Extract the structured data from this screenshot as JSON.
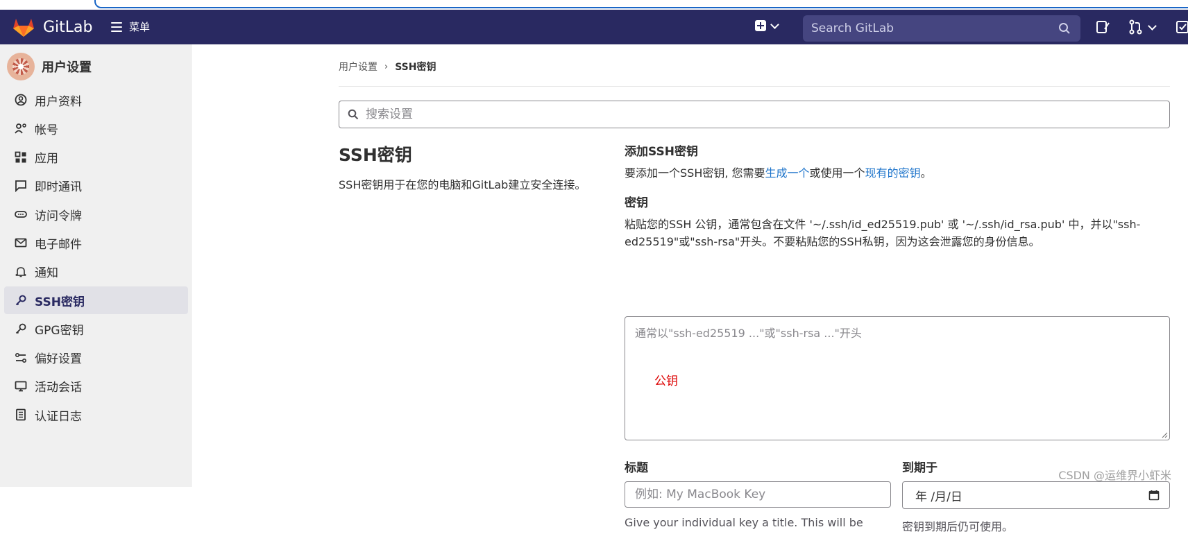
{
  "navbar": {
    "brand": "GitLab",
    "menu_label": "菜单",
    "search_placeholder": "Search GitLab"
  },
  "sidebar": {
    "title": "用户设置",
    "items": [
      {
        "label": "用户资料",
        "icon": "profile-icon"
      },
      {
        "label": "帐号",
        "icon": "account-icon"
      },
      {
        "label": "应用",
        "icon": "applications-icon"
      },
      {
        "label": "即时通讯",
        "icon": "chat-icon"
      },
      {
        "label": "访问令牌",
        "icon": "token-icon"
      },
      {
        "label": "电子邮件",
        "icon": "mail-icon"
      },
      {
        "label": "通知",
        "icon": "bell-icon"
      },
      {
        "label": "SSH密钥",
        "icon": "key-icon",
        "active": true
      },
      {
        "label": "GPG密钥",
        "icon": "key-icon"
      },
      {
        "label": "偏好设置",
        "icon": "preferences-icon"
      },
      {
        "label": "活动会话",
        "icon": "monitor-icon"
      },
      {
        "label": "认证日志",
        "icon": "log-icon"
      }
    ]
  },
  "breadcrumb": {
    "parent": "用户设置",
    "current": "SSH密钥"
  },
  "settings_search": {
    "placeholder": "搜索设置"
  },
  "intro": {
    "heading": "SSH密钥",
    "description": "SSH密钥用于在您的电脑和GitLab建立安全连接。"
  },
  "add_key": {
    "heading": "添加SSH密钥",
    "text_before": "要添加一个SSH密钥, 您需要",
    "link_generate": "生成一个",
    "text_middle": "或使用一个",
    "link_existing": "现有的密钥",
    "text_after": "。",
    "key_label": "密钥",
    "key_help": "粘贴您的SSH 公钥，通常包含在文件 '~/.ssh/id_ed25519.pub' 或 '~/.ssh/id_rsa.pub' 中，并以\"ssh-ed25519\"或\"ssh-rsa\"开头。不要粘贴您的SSH私钥，因为这会泄露您的身份信息。",
    "key_placeholder": "通常以\"ssh-ed25519 ...\"或\"ssh-rsa ...\"开头",
    "key_annotation": "公钥",
    "title_label": "标题",
    "title_placeholder": "例如: My MacBook Key",
    "title_help": "Give your individual key a title. This will be",
    "expires_label": "到期于",
    "expires_value": "年 /月/日",
    "expires_help": "密钥到期后仍可使用。"
  },
  "watermark": "CSDN @运维界小虾米",
  "colors": {
    "navbar": "#292961",
    "link": "#1f75cb",
    "annotation": "#dd0000",
    "sidebar_bg": "#f0f0f0"
  }
}
